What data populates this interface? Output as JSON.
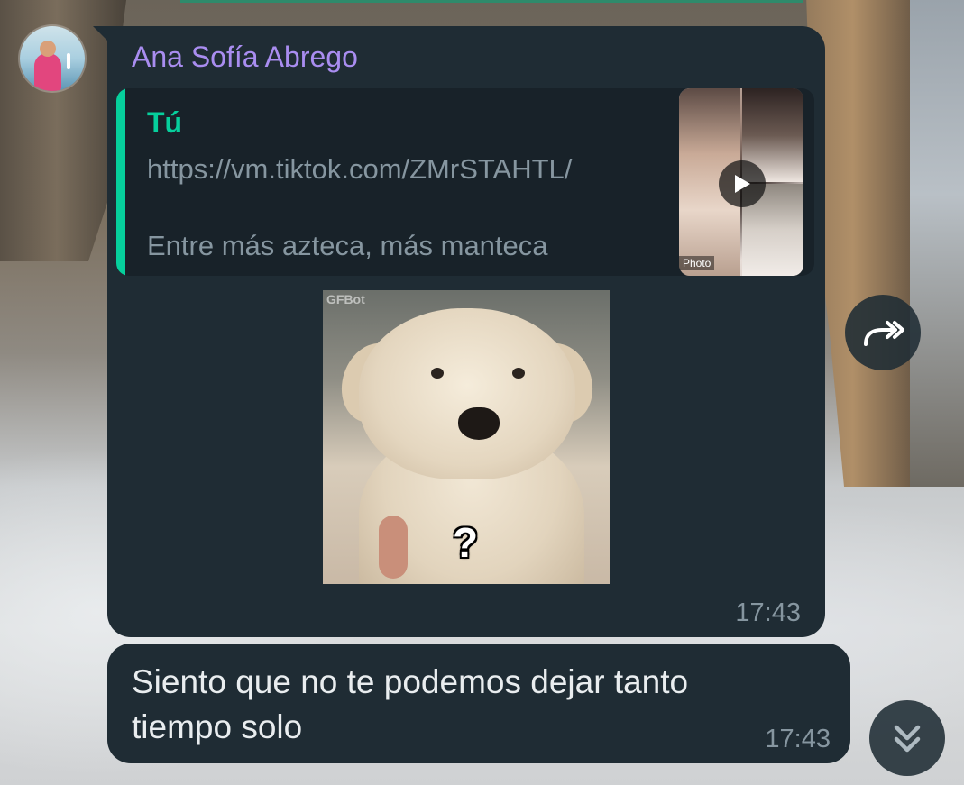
{
  "chat": {
    "sender_name": "Ana Sofía Abrego",
    "messages": [
      {
        "reply_quote": {
          "author": "Tú",
          "link": "https://vm.tiktok.com/ZMrSTAHTL/",
          "caption": "Entre más azteca, más manteca",
          "thumbnail_text": "Photo"
        },
        "media": {
          "watermark": "GFBot",
          "overlay_text": "?"
        },
        "time": "17:43"
      },
      {
        "text": "Siento que no te podemos dejar tanto tiempo solo",
        "time": "17:43"
      }
    ]
  },
  "icons": {
    "avatar": "avatar-photo",
    "play": "play-icon",
    "forward": "forward-icon",
    "scroll_down": "chevron-double-down-icon"
  },
  "colors": {
    "bubble": "#1f2c34",
    "quote_bg": "#182229",
    "quote_accent": "#06cf9c",
    "sender_name": "#a98df0",
    "meta_text": "#8696a0",
    "primary_text": "#e9edef"
  }
}
